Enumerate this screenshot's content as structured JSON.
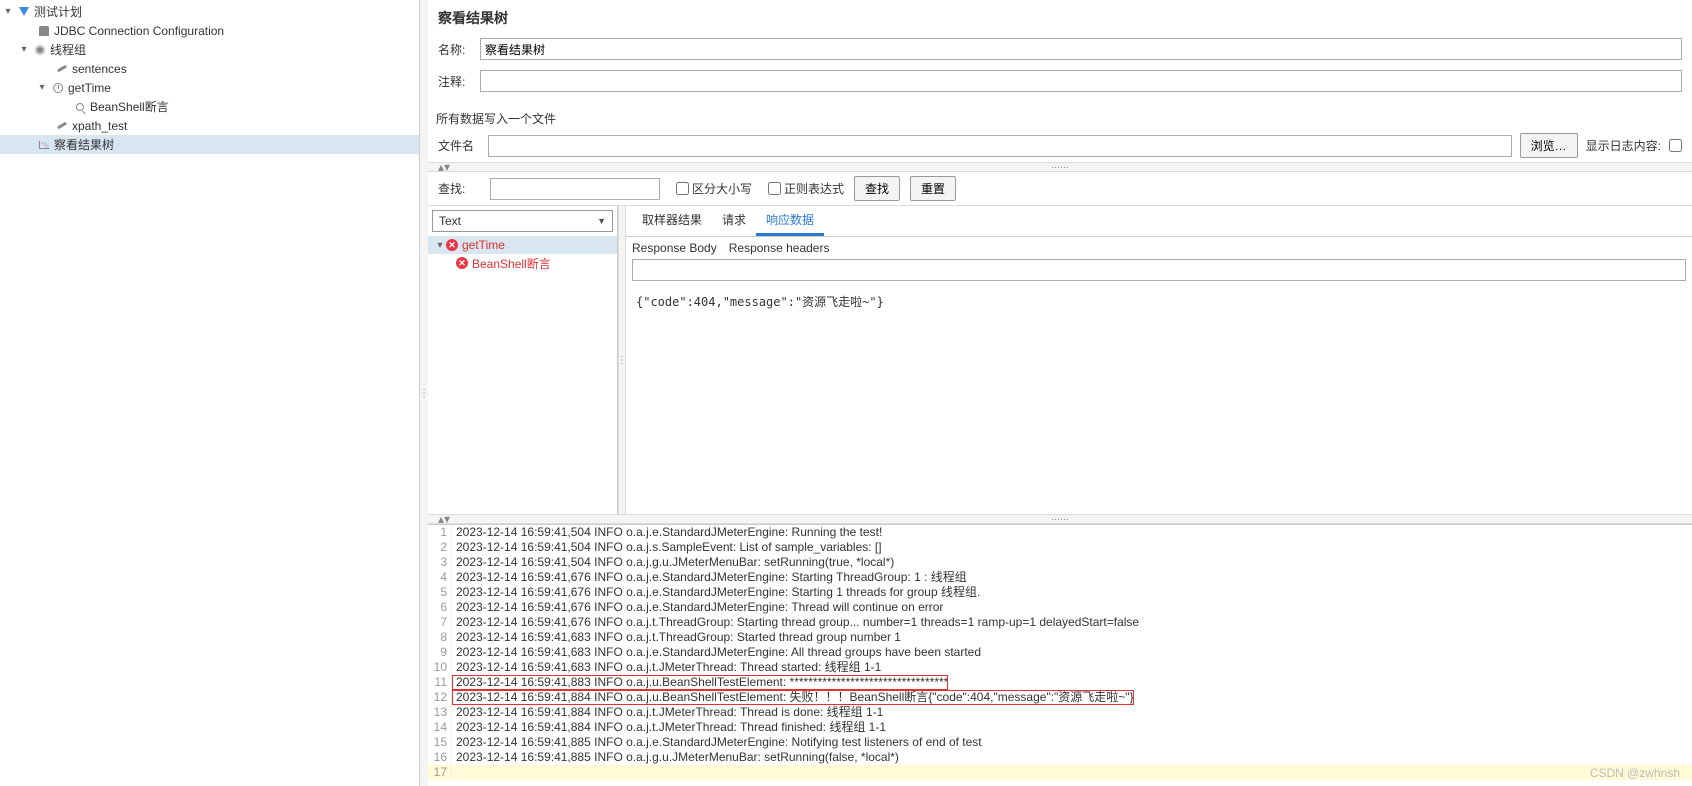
{
  "tree": {
    "root": "测试计划",
    "items": [
      "JDBC Connection Configuration",
      "线程组",
      "sentences",
      "getTime",
      "BeanShell断言",
      "xpath_test",
      "察看结果树"
    ]
  },
  "page": {
    "title": "察看结果树",
    "nameLabel": "名称:",
    "nameValue": "察看结果树",
    "commentLabel": "注释:",
    "commentValue": "",
    "fileSection": "所有数据写入一个文件",
    "fileLabel": "文件名",
    "browse": "浏览…",
    "showLog": "显示日志内容:",
    "searchLabel": "查找:",
    "caseSensitive": "区分大小写",
    "regex": "正则表达式",
    "searchBtn": "查找",
    "resetBtn": "重置",
    "typeSelect": "Text",
    "resultTree": {
      "sample": "getTime",
      "assertion": "BeanShell断言"
    },
    "tabs": [
      "取样器结果",
      "请求",
      "响应数据"
    ],
    "activeTab": 2,
    "subtabs": [
      "Response Body",
      "Response headers"
    ],
    "responseBody": "{\"code\":404,\"message\":\"资源飞走啦~\"}"
  },
  "log": [
    "2023-12-14 16:59:41,504 INFO o.a.j.e.StandardJMeterEngine: Running the test!",
    "2023-12-14 16:59:41,504 INFO o.a.j.s.SampleEvent: List of sample_variables: []",
    "2023-12-14 16:59:41,504 INFO o.a.j.g.u.JMeterMenuBar: setRunning(true, *local*)",
    "2023-12-14 16:59:41,676 INFO o.a.j.e.StandardJMeterEngine: Starting ThreadGroup: 1 : 线程组",
    "2023-12-14 16:59:41,676 INFO o.a.j.e.StandardJMeterEngine: Starting 1 threads for group 线程组.",
    "2023-12-14 16:59:41,676 INFO o.a.j.e.StandardJMeterEngine: Thread will continue on error",
    "2023-12-14 16:59:41,676 INFO o.a.j.t.ThreadGroup: Starting thread group... number=1 threads=1 ramp-up=1 delayedStart=false",
    "2023-12-14 16:59:41,683 INFO o.a.j.t.ThreadGroup: Started thread group number 1",
    "2023-12-14 16:59:41,683 INFO o.a.j.e.StandardJMeterEngine: All thread groups have been started",
    "2023-12-14 16:59:41,683 INFO o.a.j.t.JMeterThread: Thread started: 线程组 1-1",
    "2023-12-14 16:59:41,883 INFO o.a.j.u.BeanShellTestElement: **********************************",
    "2023-12-14 16:59:41,884 INFO o.a.j.u.BeanShellTestElement: 失败！！！BeanShell断言{\"code\":404,\"message\":\"资源飞走啦~\"}",
    "2023-12-14 16:59:41,884 INFO o.a.j.t.JMeterThread: Thread is done: 线程组 1-1",
    "2023-12-14 16:59:41,884 INFO o.a.j.t.JMeterThread: Thread finished: 线程组 1-1",
    "2023-12-14 16:59:41,885 INFO o.a.j.e.StandardJMeterEngine: Notifying test listeners of end of test",
    "2023-12-14 16:59:41,885 INFO o.a.j.g.u.JMeterMenuBar: setRunning(false, *local*)",
    ""
  ],
  "logHighlight": [
    10,
    11
  ],
  "watermark": "CSDN @zwhnsh"
}
